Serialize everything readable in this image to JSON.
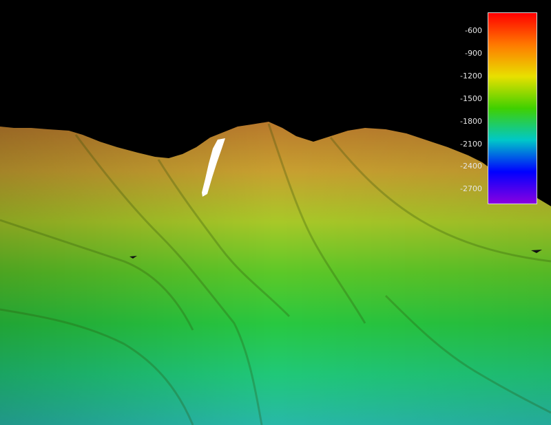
{
  "scene": {
    "background_color": "#000000",
    "terrain_palette": [
      "#b8782c",
      "#c8a030",
      "#a8c828",
      "#5cc828",
      "#28c840",
      "#20c878",
      "#28b8a8"
    ],
    "track_color": "#ffffff",
    "marker_color": "#101010"
  },
  "depth_scale": {
    "labels": [
      "-600",
      "-900",
      "-1200",
      "-1500",
      "-1800",
      "-2100",
      "-2400",
      "-2700"
    ],
    "min": -2900,
    "max": -350,
    "colors": [
      "#ff0000",
      "#ff7a00",
      "#e8e000",
      "#40d000",
      "#00c8c8",
      "#0000ff",
      "#8a00e0"
    ]
  }
}
